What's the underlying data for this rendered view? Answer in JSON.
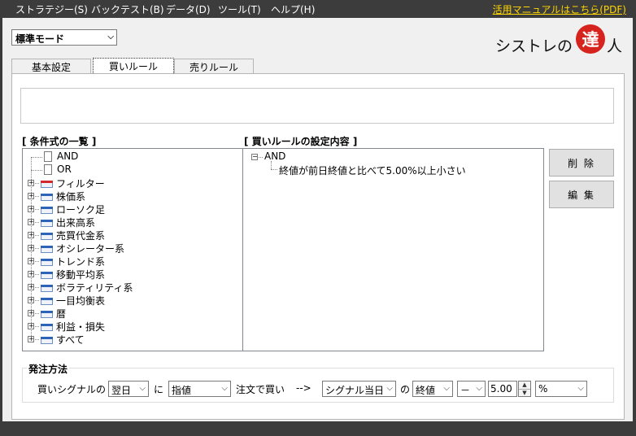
{
  "menu": {
    "items": [
      "ストラテジー(S)",
      "バックテスト(B)",
      "データ(D)",
      "ツール(T)",
      "ヘルプ(H)"
    ],
    "manual_link": "活用マニュアルはこちら(PDF)"
  },
  "mode": {
    "selected": "標準モード"
  },
  "logo": {
    "text_before": "シストレの",
    "mark": "達",
    "text_after": "人"
  },
  "tabs": [
    "基本設定",
    "買いルール",
    "売りルール"
  ],
  "active_tab": "買いルール",
  "conditions": {
    "title": "[ 条件式の一覧 ]",
    "items": [
      {
        "label": "AND",
        "kind": "doc"
      },
      {
        "label": "OR",
        "kind": "doc"
      },
      {
        "label": "フィルター",
        "kind": "folder-red"
      },
      {
        "label": "株価系",
        "kind": "folder"
      },
      {
        "label": "ローソク足",
        "kind": "folder"
      },
      {
        "label": "出来高系",
        "kind": "folder"
      },
      {
        "label": "売買代金系",
        "kind": "folder"
      },
      {
        "label": "オシレーター系",
        "kind": "folder"
      },
      {
        "label": "トレンド系",
        "kind": "folder"
      },
      {
        "label": "移動平均系",
        "kind": "folder"
      },
      {
        "label": "ボラティリティ系",
        "kind": "folder"
      },
      {
        "label": "一目均衡表",
        "kind": "folder"
      },
      {
        "label": "暦",
        "kind": "folder"
      },
      {
        "label": "利益・損失",
        "kind": "folder"
      },
      {
        "label": "すべて",
        "kind": "folder"
      }
    ]
  },
  "rules": {
    "title": "[ 買いルールの設定内容 ]",
    "root": "AND",
    "child": "終値が前日終値と比べて5.00%以上小さい"
  },
  "buttons": {
    "delete": "削 除",
    "edit": "編 集"
  },
  "order": {
    "title": "発注方法",
    "label1": "買いシグナルの",
    "timing": "翌日",
    "label2": "に",
    "order_type": "指値",
    "label3": "注文で買い",
    "arrow": "-->",
    "base_day": "シグナル当日",
    "label4": "の",
    "price_basis": "終値",
    "sign": "－",
    "amount": "5.00",
    "unit": "%"
  }
}
